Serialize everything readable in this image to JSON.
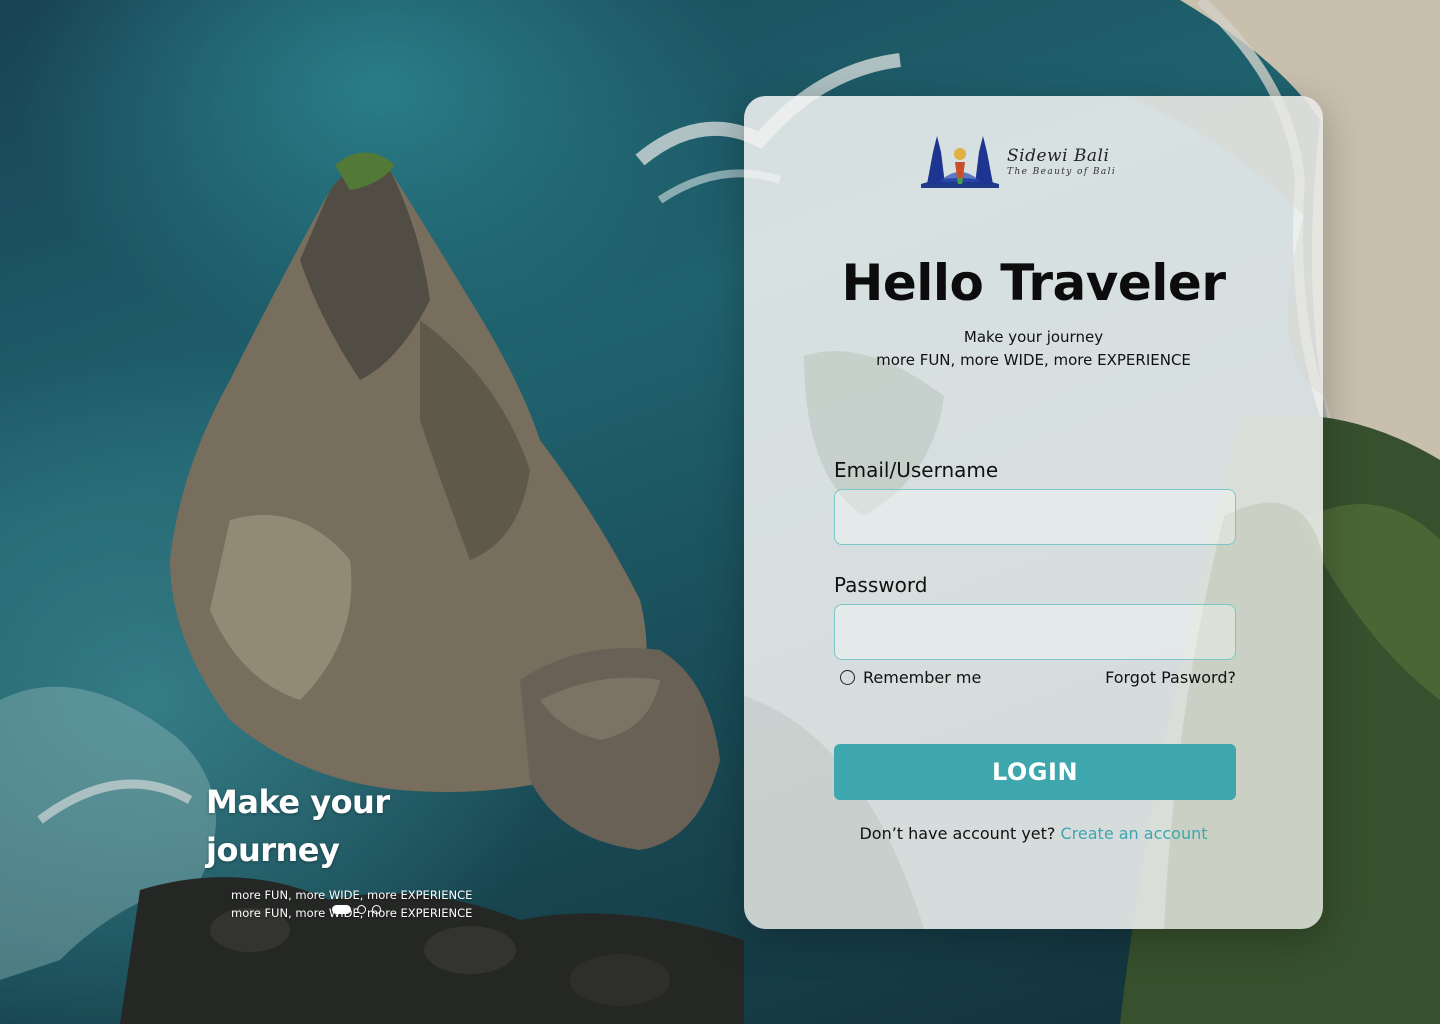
{
  "colors": {
    "accent": "#3ea6ad",
    "input_border": "#7cc6c9",
    "text": "#111111",
    "card_bg": "#f6f6f4"
  },
  "hero": {
    "title": "Make your journey",
    "lines": [
      "more FUN, more WIDE, more EXPERIENCE",
      "more FUN, more WIDE, more EXPERIENCE"
    ],
    "slides": {
      "total": 3,
      "active": 1
    }
  },
  "brand": {
    "name": "Sidewi Bali",
    "tagline": "The Beauty of Bali",
    "logo_icon": "temple-gate-logo"
  },
  "login": {
    "title": "Hello Traveler",
    "subtitle_line1": "Make your journey",
    "subtitle_line2": "more FUN, more WIDE, more EXPERIENCE",
    "email_label": "Email/Username",
    "email_value": "",
    "password_label": "Password",
    "password_value": "",
    "remember_label": "Remember me",
    "remember_checked": false,
    "forgot_label": "Forgot Pasword?",
    "button_label": "LOGIN",
    "signup_prompt": "Don’t have account yet?",
    "signup_link": "Create an account"
  }
}
